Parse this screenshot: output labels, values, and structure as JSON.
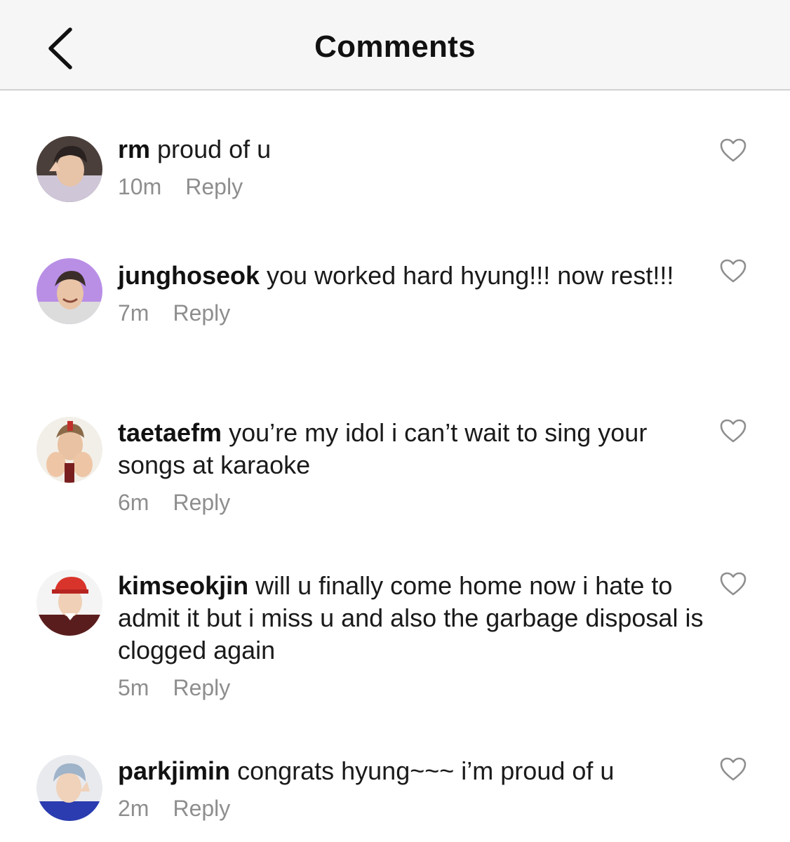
{
  "header": {
    "title": "Comments",
    "back_icon": "chevron-left-icon"
  },
  "comments": [
    {
      "username": "rm",
      "text": "proud of u",
      "time": "10m",
      "reply_label": "Reply",
      "like_icon": "heart-outline-icon"
    },
    {
      "username": "junghoseok",
      "text": "you worked hard hyung!!! now rest!!!",
      "time": "7m",
      "reply_label": "Reply",
      "like_icon": "heart-outline-icon"
    },
    {
      "username": "taetaefm",
      "text": "you’re my idol i can’t wait to sing your songs at karaoke",
      "time": "6m",
      "reply_label": "Reply",
      "like_icon": "heart-outline-icon"
    },
    {
      "username": "kimseokjin",
      "text": "will u finally come home now i hate to admit it but i miss u and also the garbage disposal is clogged again",
      "time": "5m",
      "reply_label": "Reply",
      "like_icon": "heart-outline-icon"
    },
    {
      "username": "parkjimin",
      "text": "congrats hyung~~~ i’m proud of u",
      "time": "2m",
      "reply_label": "Reply",
      "like_icon": "heart-outline-icon"
    }
  ],
  "colors": {
    "header_bg": "#f6f6f6",
    "text": "#111111",
    "meta_text": "#8e8e8e",
    "icon_stroke": "#8e8e8e"
  }
}
